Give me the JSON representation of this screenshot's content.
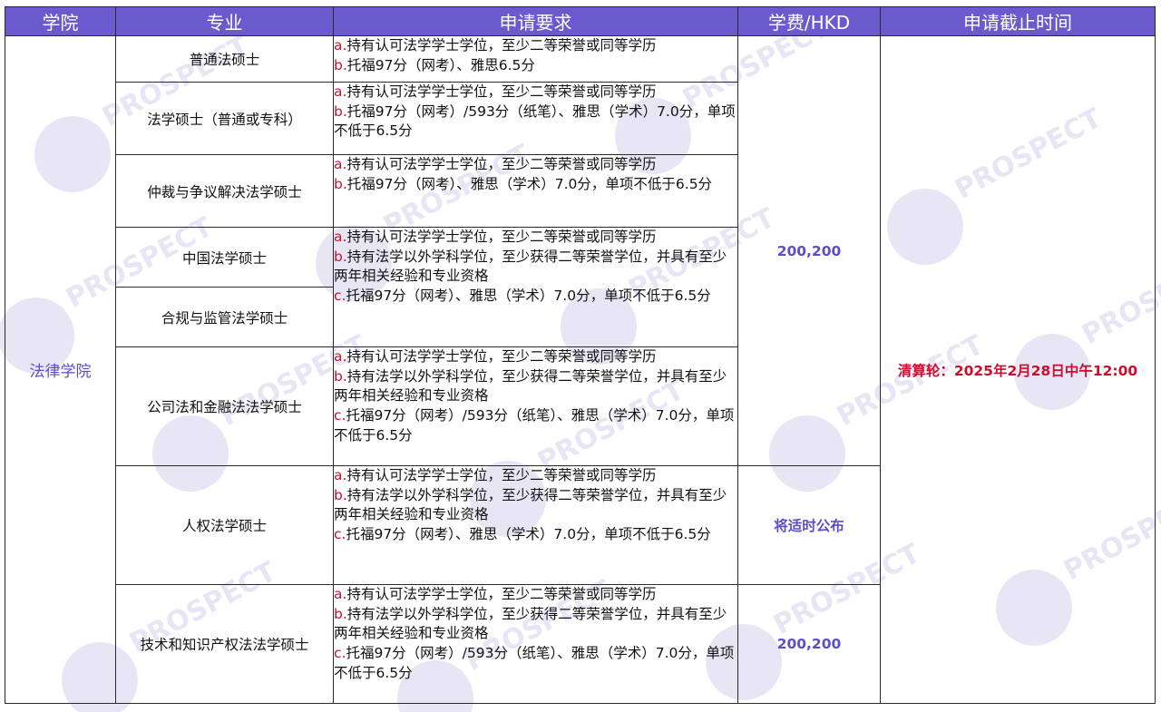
{
  "header": {
    "school": "学院",
    "major": "专业",
    "requirements": "申请要求",
    "fee": "学费/HKD",
    "deadline": "申请截止时间"
  },
  "school_name": "法律学院",
  "deadline_text": "清算轮：2025年2月28日中午12:00",
  "watermark_text": "PROSPECT",
  "colors": {
    "header_bg": "#6a5acd",
    "accent_text": "#5b4fc9",
    "marker_red": "#c8102e",
    "watermark": "#e8e6f5"
  },
  "programs": [
    "普通法硕士",
    "法学硕士（普通或专科）",
    "仲裁与争议解决法学硕士",
    "中国法学硕士",
    "合规与监管法学硕士",
    "公司法和金融法法学硕士",
    "人权法学硕士",
    "技术和知识产权法法学硕士"
  ],
  "requirements": [
    [
      {
        "mark": "a.",
        "text": "持有认可法学学士学位，至少二等荣誉或同等学历"
      },
      {
        "mark": "b.",
        "text": "托福97分（网考）、雅思6.5分"
      }
    ],
    [
      {
        "mark": "a.",
        "text": "持有认可法学学士学位，至少二等荣誉或同等学历"
      },
      {
        "mark": "b.",
        "text": "托福97分（网考）/593分（纸笔）、雅思（学术）7.0分，单项不低于6.5分"
      }
    ],
    [
      {
        "mark": "a.",
        "text": "持有认可法学学士学位，至少二等荣誉或同等学历"
      },
      {
        "mark": "b.",
        "text": "托福97分（网考）、雅思（学术）7.0分，单项不低于6.5分"
      }
    ],
    [
      {
        "mark": "a.",
        "text": "持有认可法学学士学位，至少二等荣誉或同等学历"
      },
      {
        "mark": "b.",
        "text": "持有法学以外学科学位，至少获得二等荣誉学位，并具有至少两年相关经验和专业资格"
      },
      {
        "mark": "c.",
        "text": "托福97分（网考）、雅思（学术）7.0分，单项不低于6.5分"
      }
    ],
    [
      {
        "mark": "a.",
        "text": "持有认可法学学士学位，至少二等荣誉或同等学历"
      },
      {
        "mark": "b.",
        "text": "持有法学以外学科学位，至少获得二等荣誉学位，并具有至少两年相关经验和专业资格"
      },
      {
        "mark": "c.",
        "text": "托福97分（网考）/593分（纸笔）、雅思（学术）7.0分，单项不低于6.5分"
      }
    ],
    [
      {
        "mark": "a.",
        "text": "持有认可法学学士学位，至少二等荣誉或同等学历"
      },
      {
        "mark": "b.",
        "text": "持有法学以外学科学位，至少获得二等荣誉学位，并具有至少两年相关经验和专业资格"
      },
      {
        "mark": "c.",
        "text": "托福97分（网考）、雅思（学术）7.0分，单项不低于6.5分"
      }
    ],
    [
      {
        "mark": "a.",
        "text": "持有认可法学学士学位，至少二等荣誉或同等学历"
      },
      {
        "mark": "b.",
        "text": "持有法学以外学科学位，至少获得二等荣誉学位，并具有至少两年相关经验和专业资格"
      },
      {
        "mark": "c.",
        "text": "托福97分（网考）/593分（纸笔）、雅思（学术）7.0分，单项不低于6.5分"
      }
    ]
  ],
  "fees": [
    "200,200",
    "将适时公布",
    "200,200"
  ]
}
